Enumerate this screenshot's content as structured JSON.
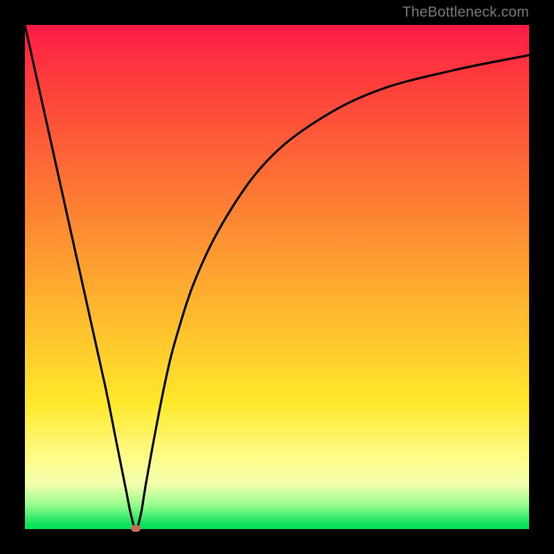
{
  "attribution": "TheBottleneck.com",
  "colors": {
    "gradient_top": "#fc1b48",
    "gradient_bottom": "#09e25b",
    "curve_stroke": "#000000",
    "min_marker": "#c76a58",
    "frame": "#000000"
  },
  "chart_data": {
    "type": "line",
    "title": "",
    "xlabel": "",
    "ylabel": "",
    "xlim": [
      0,
      100
    ],
    "ylim": [
      0,
      100
    ],
    "grid": false,
    "legend": false,
    "annotations": [
      {
        "type": "marker",
        "x": 22,
        "y": 0,
        "label": "minimum",
        "color": "#c76a58"
      }
    ],
    "series": [
      {
        "name": "bottleneck-curve",
        "x": [
          0,
          4,
          8,
          12,
          16,
          18,
          20,
          21,
          22,
          23,
          24,
          26,
          28,
          30,
          34,
          40,
          48,
          58,
          70,
          85,
          100
        ],
        "y": [
          100,
          82,
          64,
          46,
          28,
          18,
          8,
          3,
          0,
          3,
          9,
          20,
          30,
          38,
          50,
          62,
          73,
          81,
          87,
          91,
          94
        ]
      }
    ]
  }
}
